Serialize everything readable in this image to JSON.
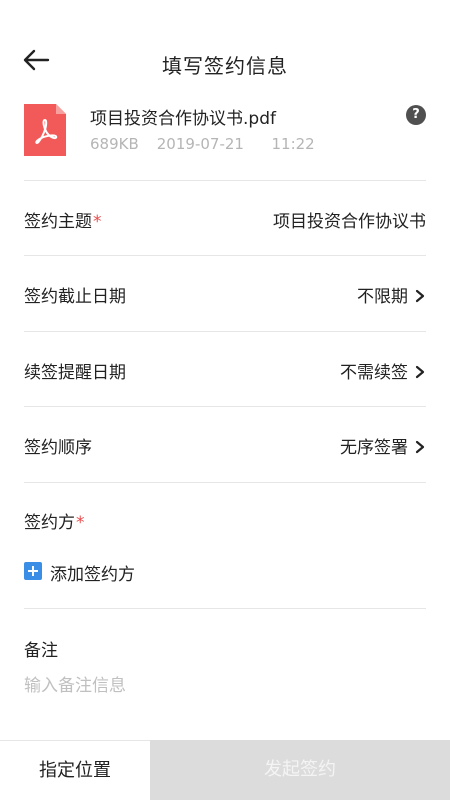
{
  "header": {
    "title": "填写签约信息",
    "back_icon": "arrow-left-icon"
  },
  "file": {
    "icon": "pdf-file-icon",
    "icon_color": "#f25a5a",
    "name": "项目投资合作协议书.pdf",
    "size": "689KB",
    "date": "2019-07-21",
    "time": "11:22",
    "help_icon": "question-circle-icon",
    "help_glyph": "?"
  },
  "form": {
    "required_mark": "*",
    "subject": {
      "label": "签约主题",
      "value": "项目投资合作协议书"
    },
    "deadline": {
      "label": "签约截止日期",
      "value": "不限期"
    },
    "renewal_reminder": {
      "label": "续签提醒日期",
      "value": "不需续签"
    },
    "order": {
      "label": "签约顺序",
      "value": "无序签署"
    }
  },
  "parties": {
    "label": "签约方",
    "add_label": "添加签约方",
    "add_icon": "plus-square-icon",
    "accent": "#3a8ee6"
  },
  "remark": {
    "label": "备注",
    "placeholder": "输入备注信息"
  },
  "footer": {
    "position_label": "指定位置",
    "submit_label": "发起签约",
    "submit_bg": "#dcdcdc"
  }
}
